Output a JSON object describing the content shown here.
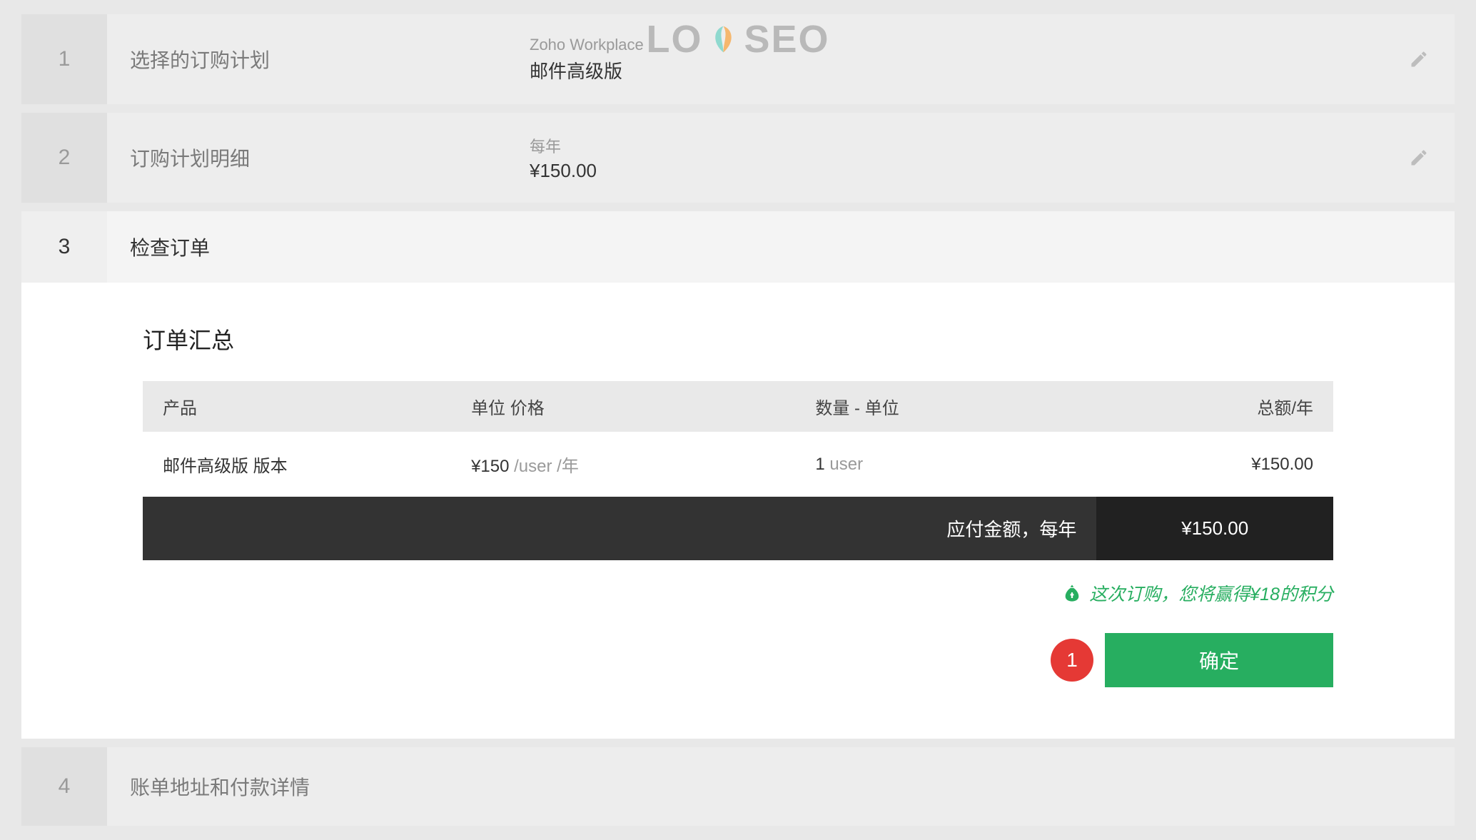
{
  "watermark": {
    "lo": "LO",
    "seo": "SEO"
  },
  "steps": {
    "s1": {
      "num": "1",
      "title": "选择的订购计划",
      "value_label": "Zoho Workplace",
      "value_text": "邮件高级版"
    },
    "s2": {
      "num": "2",
      "title": "订购计划明细",
      "value_label": "每年",
      "value_text": "¥150.00"
    },
    "s3": {
      "num": "3",
      "title": "检查订单"
    },
    "s4": {
      "num": "4",
      "title": "账单地址和付款详情"
    }
  },
  "summary": {
    "heading": "订单汇总",
    "columns": {
      "product": "产品",
      "unit_price": "单位 价格",
      "qty": "数量 - 单位",
      "total": "总额/年"
    },
    "row": {
      "product": "邮件高级版 版本",
      "price_value": "¥150",
      "price_unit": " /user /年",
      "qty_value": "1",
      "qty_unit": " user",
      "total": "¥150.00"
    },
    "total_label": "应付金额，每年",
    "total_value": "¥150.00",
    "points_line": "这次订购，您将赢得¥18的积分",
    "annotation_badge": "1",
    "confirm": "确定"
  }
}
